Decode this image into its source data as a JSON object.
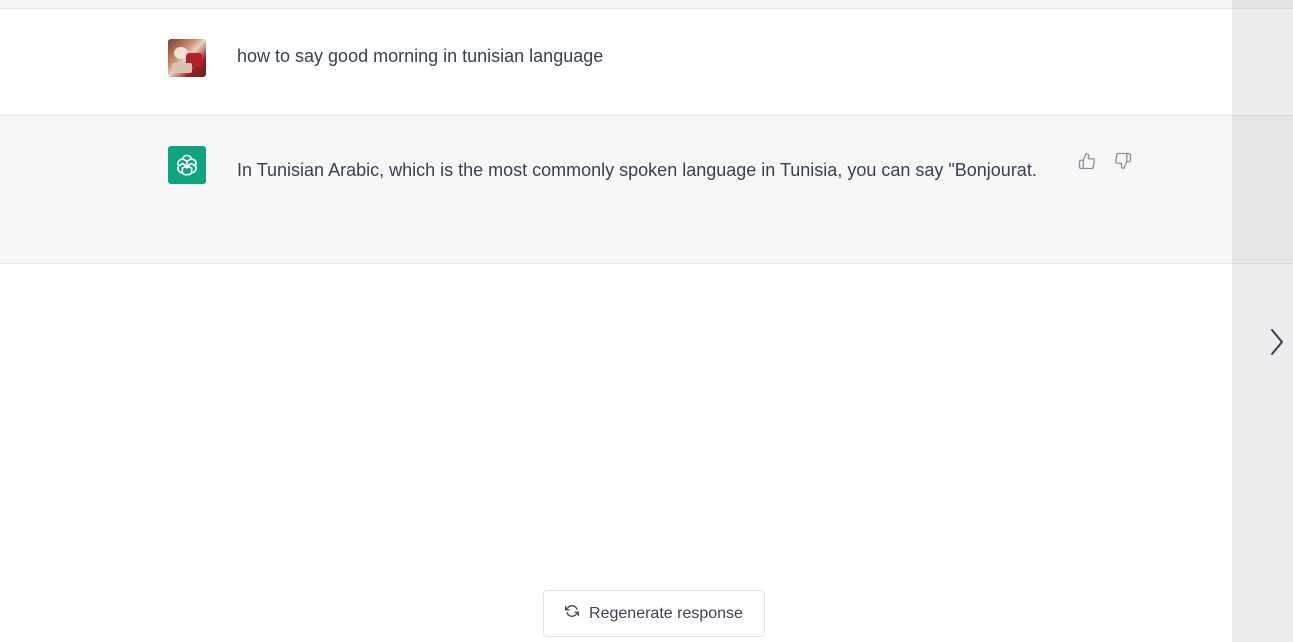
{
  "conversation": {
    "user_message": {
      "avatar_icon": "user-photo-avatar",
      "text": "how to say good morning in tunisian language"
    },
    "assistant_message": {
      "avatar_icon": "openai-logo-icon",
      "avatar_color": "#10a37f",
      "text": "In Tunisian Arabic, which is the most commonly spoken language in Tunisia, you can say \"Bonjourat.",
      "feedback": {
        "thumbs_up_icon": "thumbs-up-icon",
        "thumbs_down_icon": "thumbs-down-icon"
      }
    }
  },
  "footer": {
    "regenerate_label": "Regenerate response",
    "regenerate_icon": "refresh-icon"
  },
  "side_panel": {
    "expand_icon": "chevron-right-icon"
  },
  "colors": {
    "assistant_row_bg": "#f7f7f8",
    "text": "#374151",
    "accent": "#10a37f"
  }
}
